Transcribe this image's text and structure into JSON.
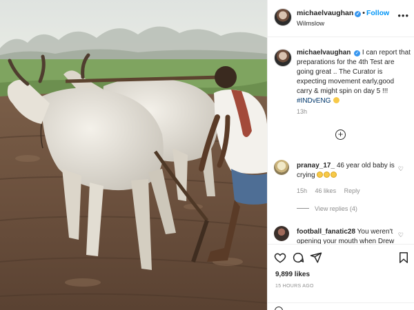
{
  "post": {
    "header": {
      "username": "michaelvaughan",
      "verified_icon": "verified-badge-icon",
      "separator": "•",
      "follow_label": "Follow",
      "location": "Wilmslow",
      "more_label": "•••"
    },
    "caption": {
      "username": "michaelvaughan",
      "text": "I can report that preparations for the 4th Test are going great .. The Curator is expecting movement early,good carry & might spin on day 5 !!! ",
      "hashtag": "#INDvENG",
      "time": "13h"
    },
    "load_more_icon": "plus-circle-icon",
    "comments": [
      {
        "username": "pranay_17_",
        "text": "46 year old baby is crying",
        "time": "15h",
        "likes": "46 likes",
        "reply_label": "Reply",
        "view_replies": "View replies (4)",
        "avatar_color": "#e9e3c2"
      },
      {
        "username": "football_fanatic28",
        "text": "You weren't opening your mouth when Drew",
        "avatar_color": "#3a2f2a"
      }
    ],
    "actions": {
      "like_icon": "heart-icon",
      "comment_icon": "comment-icon",
      "share_icon": "share-icon",
      "save_icon": "bookmark-icon",
      "likes": "9,899 likes",
      "time_ago": "15 HOURS AGO",
      "emoji_icon": "smiley-icon"
    }
  },
  "colors": {
    "accent": "#0095f6",
    "verified": "#3897f0",
    "hashtag": "#00376b",
    "muted": "#8e8e8e"
  }
}
